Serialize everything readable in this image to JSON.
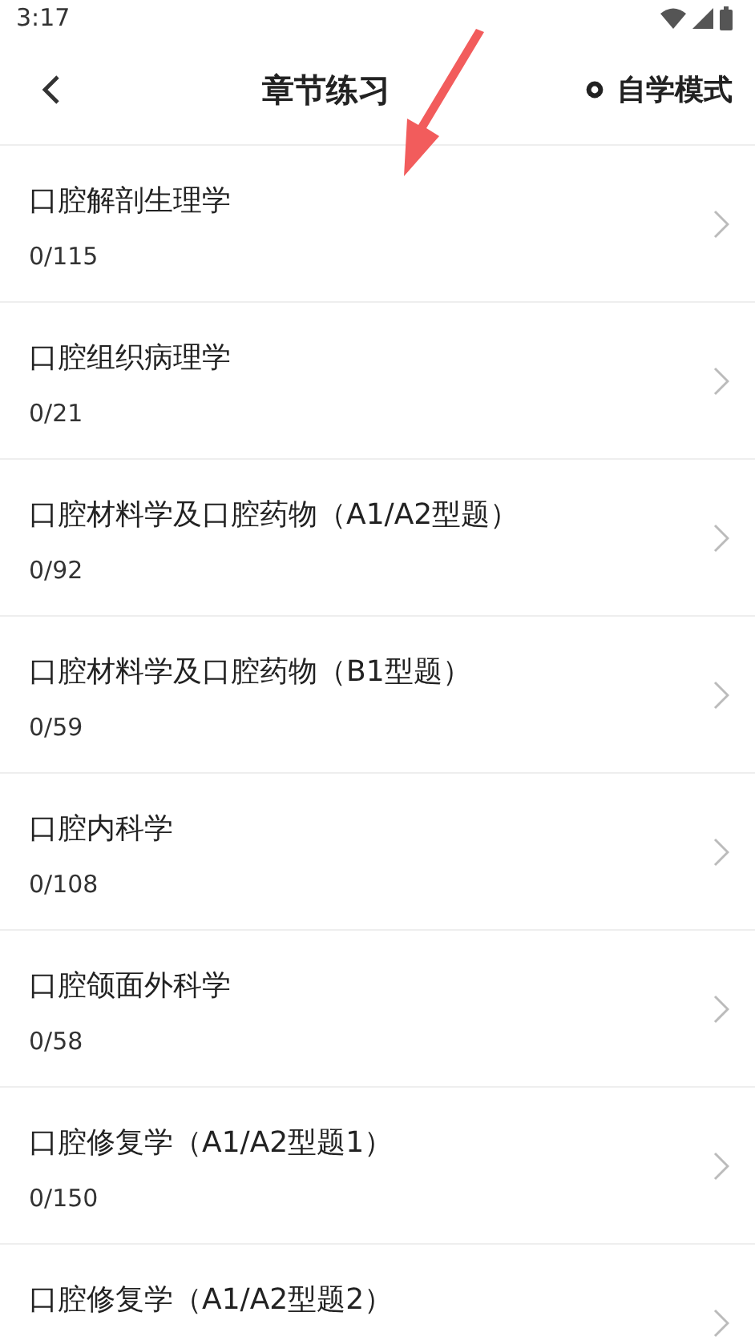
{
  "status_bar": {
    "time": "3:17"
  },
  "header": {
    "title": "章节练习",
    "action": "自学模式"
  },
  "chapters": [
    {
      "title": "口腔解剖生理学",
      "progress": "0/115"
    },
    {
      "title": "口腔组织病理学",
      "progress": "0/21"
    },
    {
      "title": "口腔材料学及口腔药物（A1/A2型题）",
      "progress": "0/92"
    },
    {
      "title": "口腔材料学及口腔药物（B1型题）",
      "progress": "0/59"
    },
    {
      "title": "口腔内科学",
      "progress": "0/108"
    },
    {
      "title": "口腔颌面外科学",
      "progress": "0/58"
    },
    {
      "title": "口腔修复学（A1/A2型题1）",
      "progress": "0/150"
    },
    {
      "title": "口腔修复学（A1/A2型题2）"
    }
  ]
}
